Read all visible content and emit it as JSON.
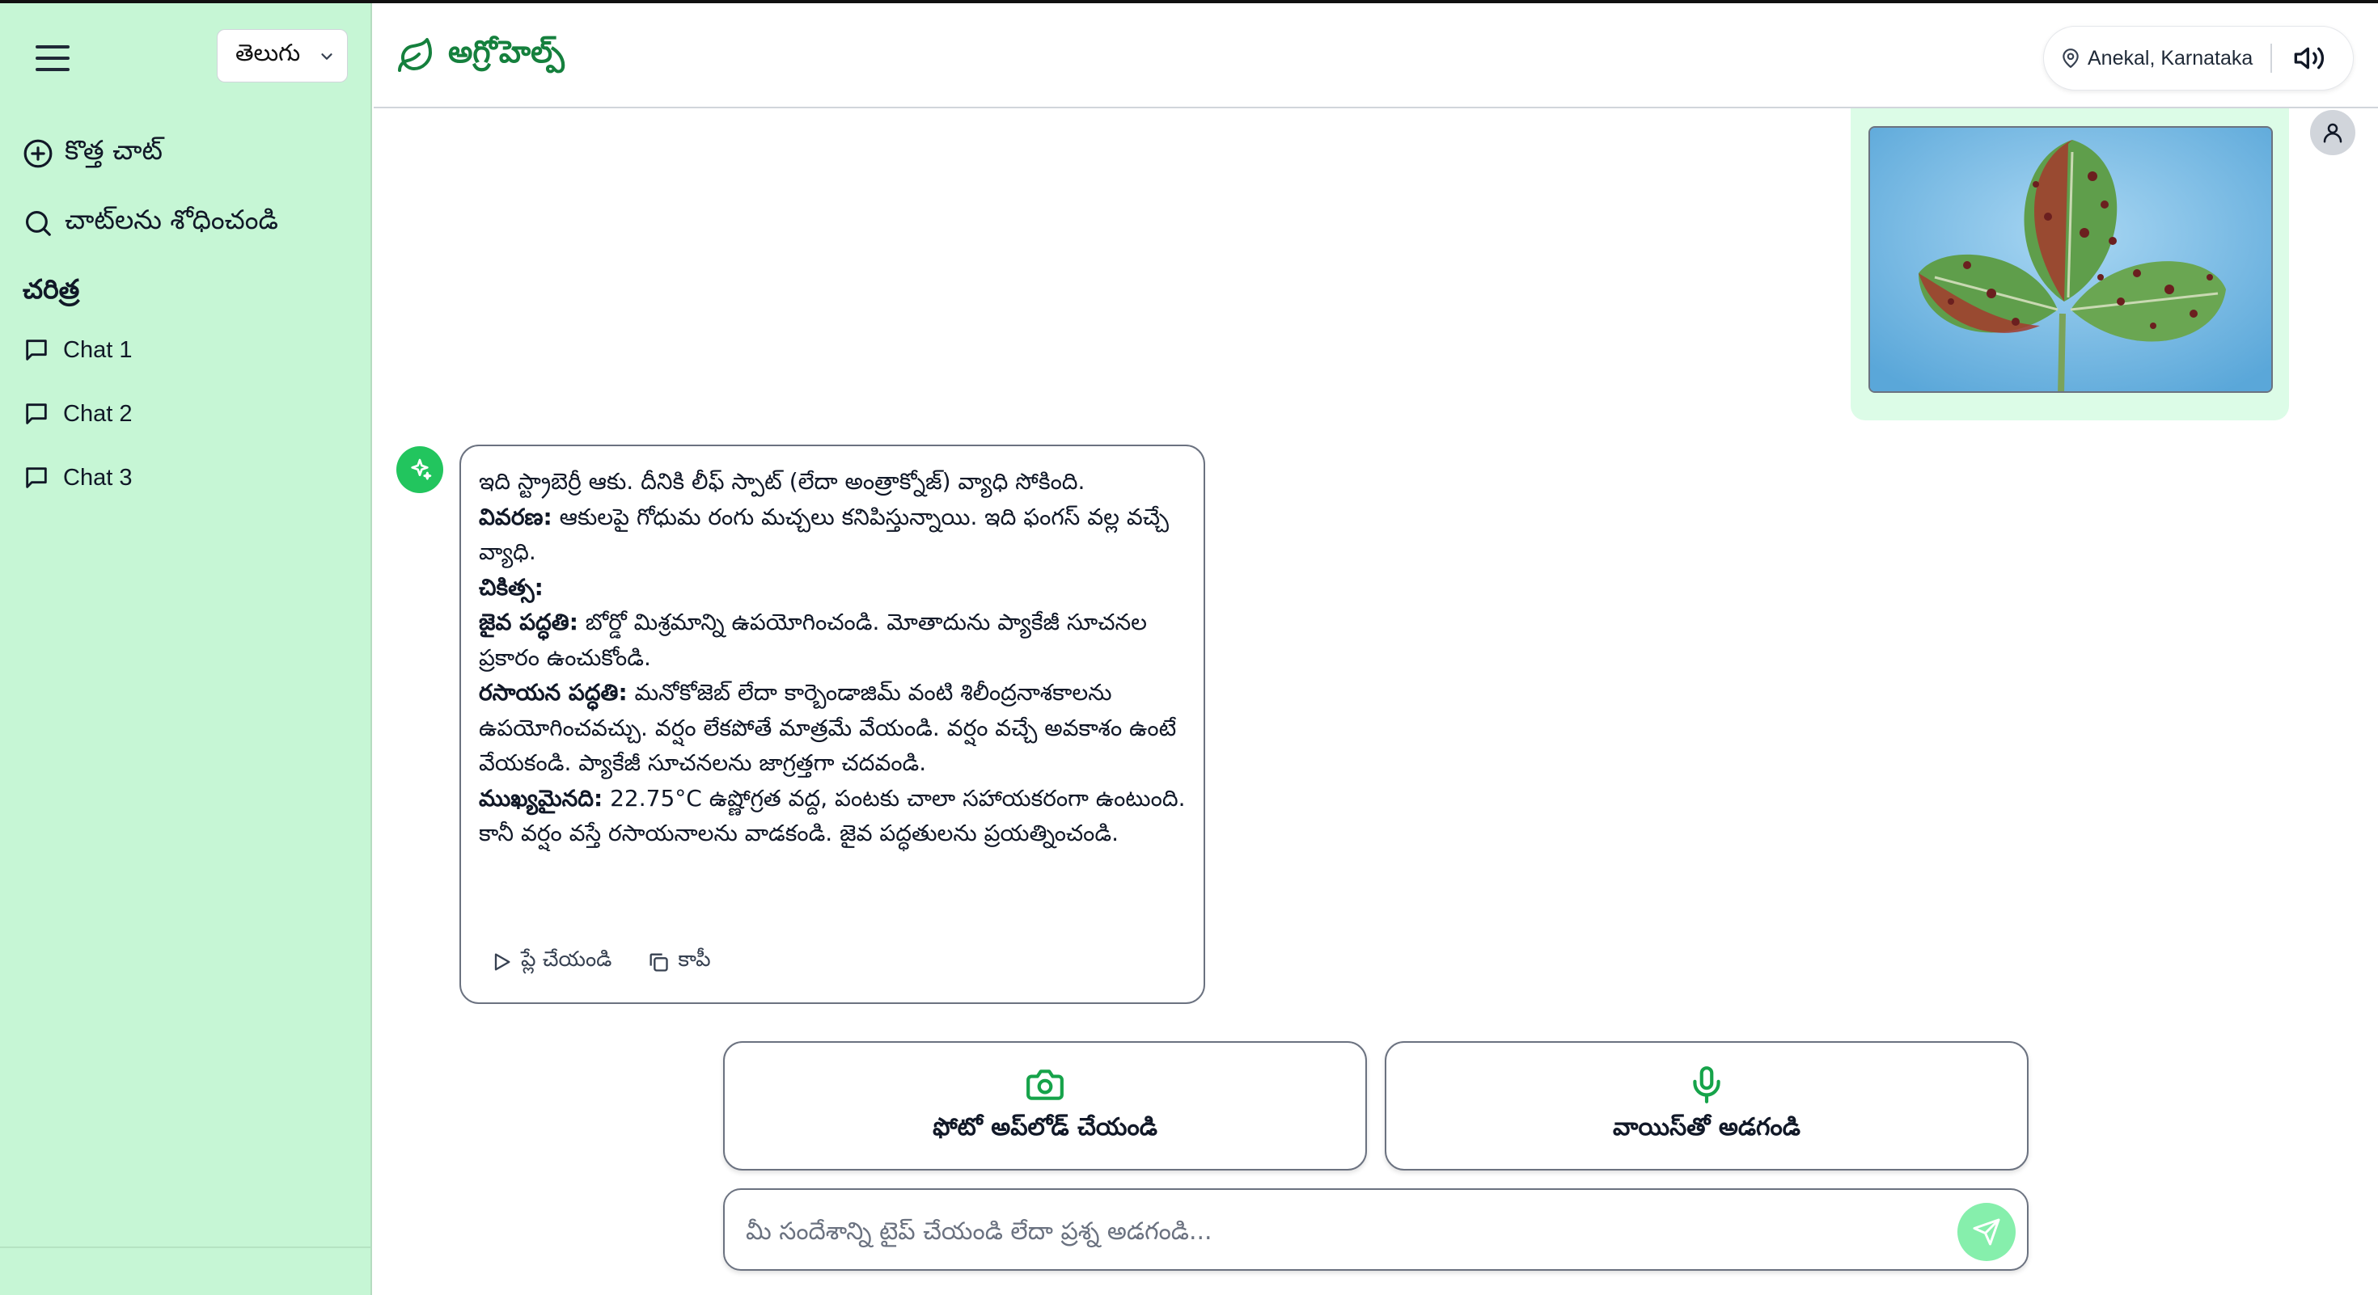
{
  "sidebar": {
    "language": "తెలుగు",
    "new_chat": "కొత్త చాట్",
    "search_chats": "చాట్‌లను శోధించండి",
    "history_heading": "చరిత్ర",
    "chats": [
      {
        "label": "Chat 1"
      },
      {
        "label": "Chat 2"
      },
      {
        "label": "Chat 3"
      }
    ]
  },
  "header": {
    "brand": "అగ్రోహెల్ప్",
    "location": "Anekal, Karnataka"
  },
  "bot_message": {
    "line1": "ఇది స్ట్రాబెర్రీ ఆకు. దీనికి లీఫ్ స్పాట్ (లేదా అంత్రాక్నోజ్) వ్యాధి సోకింది.",
    "desc_label": "వివరణ:",
    "desc_text": " ఆకులపై గోధుమ రంగు మచ్చలు కనిపిస్తున్నాయి. ఇది ఫంగస్ వల్ల వచ్చే వ్యాధి.",
    "treatment_label": "చికిత్స:",
    "bio_label": "జైవ పద్ధతి:",
    "bio_text": " బోర్డో మిశ్రమాన్ని ఉపయోగించండి. మోతాదును ప్యాకేజీ సూచనల ప్రకారం ఉంచుకోండి.",
    "chem_label": "రసాయన పద్ధతి:",
    "chem_text": " మనోకోజెబ్ లేదా కార్బెండాజిమ్ వంటి శిలీంద్రనాశకాలను ఉపయోగించవచ్చు. వర్షం లేకపోతే మాత్రమే వేయండి. వర్షం వచ్చే అవకాశం ఉంటే వేయకండి. ప్యాకేజీ సూచనలను జాగ్రత్తగా చదవండి.",
    "imp_label": "ముఖ్యమైనది:",
    "imp_text": " 22.75°C ఉష్ణోగ్రత వద్ద, పంటకు చాలా సహాయకరంగా ఉంటుంది. కానీ వర్షం వస్తే రసాయనాలను వాడకండి. జైవ పద్ధతులను ప్రయత్నించండి.",
    "play_label": "ప్లే చేయండి",
    "copy_label": "కాపీ"
  },
  "actions": {
    "upload_photo": "ఫోటో అప్‌లోడ్ చేయండి",
    "ask_voice": "వాయిస్‌తో అడగండి"
  },
  "input": {
    "placeholder": "మీ సందేశాన్ని టైప్ చేయండి లేదా ప్రశ్న అడగండి..."
  },
  "colors": {
    "sidebar_bg": "#c6f6d5",
    "brand_green": "#15803d",
    "bot_avatar": "#22c55e",
    "send_button": "#86efac",
    "user_bubble": "#dcfce7"
  },
  "icons": [
    "menu-icon",
    "chevron-down-icon",
    "plus-circle-icon",
    "search-icon",
    "chat-bubble-icon",
    "leaf-icon",
    "map-pin-icon",
    "speaker-icon",
    "user-icon",
    "sparkle-icon",
    "play-icon",
    "copy-icon",
    "camera-icon",
    "microphone-icon",
    "send-icon"
  ]
}
